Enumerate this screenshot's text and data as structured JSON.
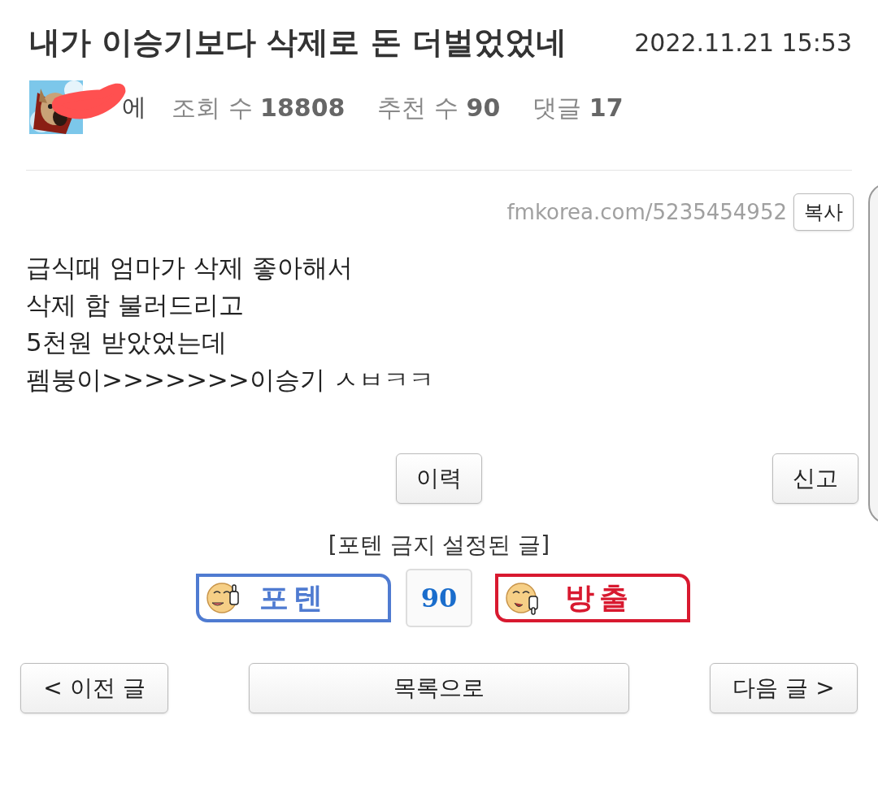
{
  "post": {
    "title": "내가 이승기보다 삭제로 돈 더벌었었네",
    "date": "2022.11.21 15:53"
  },
  "author": {
    "name_visible": "에",
    "redacted": true
  },
  "stats": [
    {
      "label": "조회 수",
      "value": "18808"
    },
    {
      "label": "추천 수",
      "value": "90"
    },
    {
      "label": "댓글",
      "value": "17"
    }
  ],
  "link": {
    "url": "fmkorea.com/5235454952",
    "copy_button": "복사"
  },
  "body": [
    "급식때 엄마가 삭제 좋아해서",
    "삭제 함 불러드리고",
    "5천원 받았었는데",
    "펨붕이>>>>>>>이승기 ㅅㅂㅋㅋ"
  ],
  "actions": {
    "history": "이력",
    "report": "신고"
  },
  "vote": {
    "notice": "[포텐 금지 설정된 글]",
    "up": "포텐",
    "count": "90",
    "down": "방출"
  },
  "nav": {
    "prev": "< 이전 글",
    "list": "목록으로",
    "next": "다음 글 >"
  }
}
